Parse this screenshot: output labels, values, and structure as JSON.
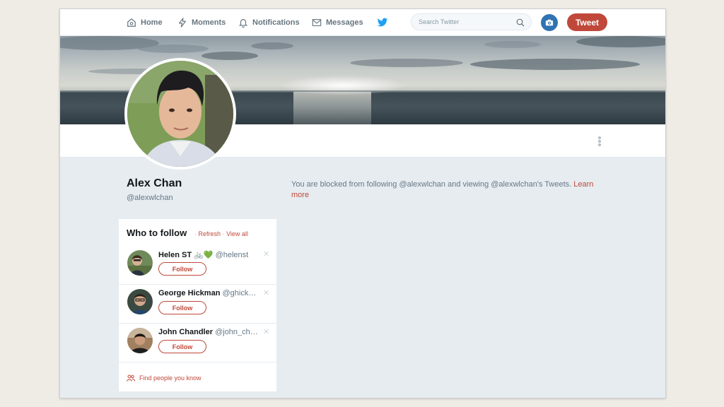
{
  "nav": {
    "home": "Home",
    "moments": "Moments",
    "notifications": "Notifications",
    "messages": "Messages",
    "search_placeholder": "Search Twitter",
    "tweet": "Tweet"
  },
  "profile": {
    "name": "Alex Chan",
    "handle": "@alexwlchan",
    "blocked_message": "You are blocked from following @alexwlchan and viewing @alexwlchan's Tweets.",
    "learn_more": "Learn more"
  },
  "who_to_follow": {
    "title": "Who to follow",
    "refresh": "Refresh",
    "view_all": "View all",
    "users": [
      {
        "name": "Helen ST 🚲💚",
        "handle": "@helenst",
        "follow": "Follow"
      },
      {
        "name": "George Hickman",
        "handle": "@ghick…",
        "follow": "Follow"
      },
      {
        "name": "John Chandler",
        "handle": "@john_ch…",
        "follow": "Follow"
      }
    ],
    "find_people": "Find people you know"
  },
  "colors": {
    "accent": "#c0483a",
    "camera": "#2f73b2",
    "twitter_bird": "#1da1f2"
  }
}
